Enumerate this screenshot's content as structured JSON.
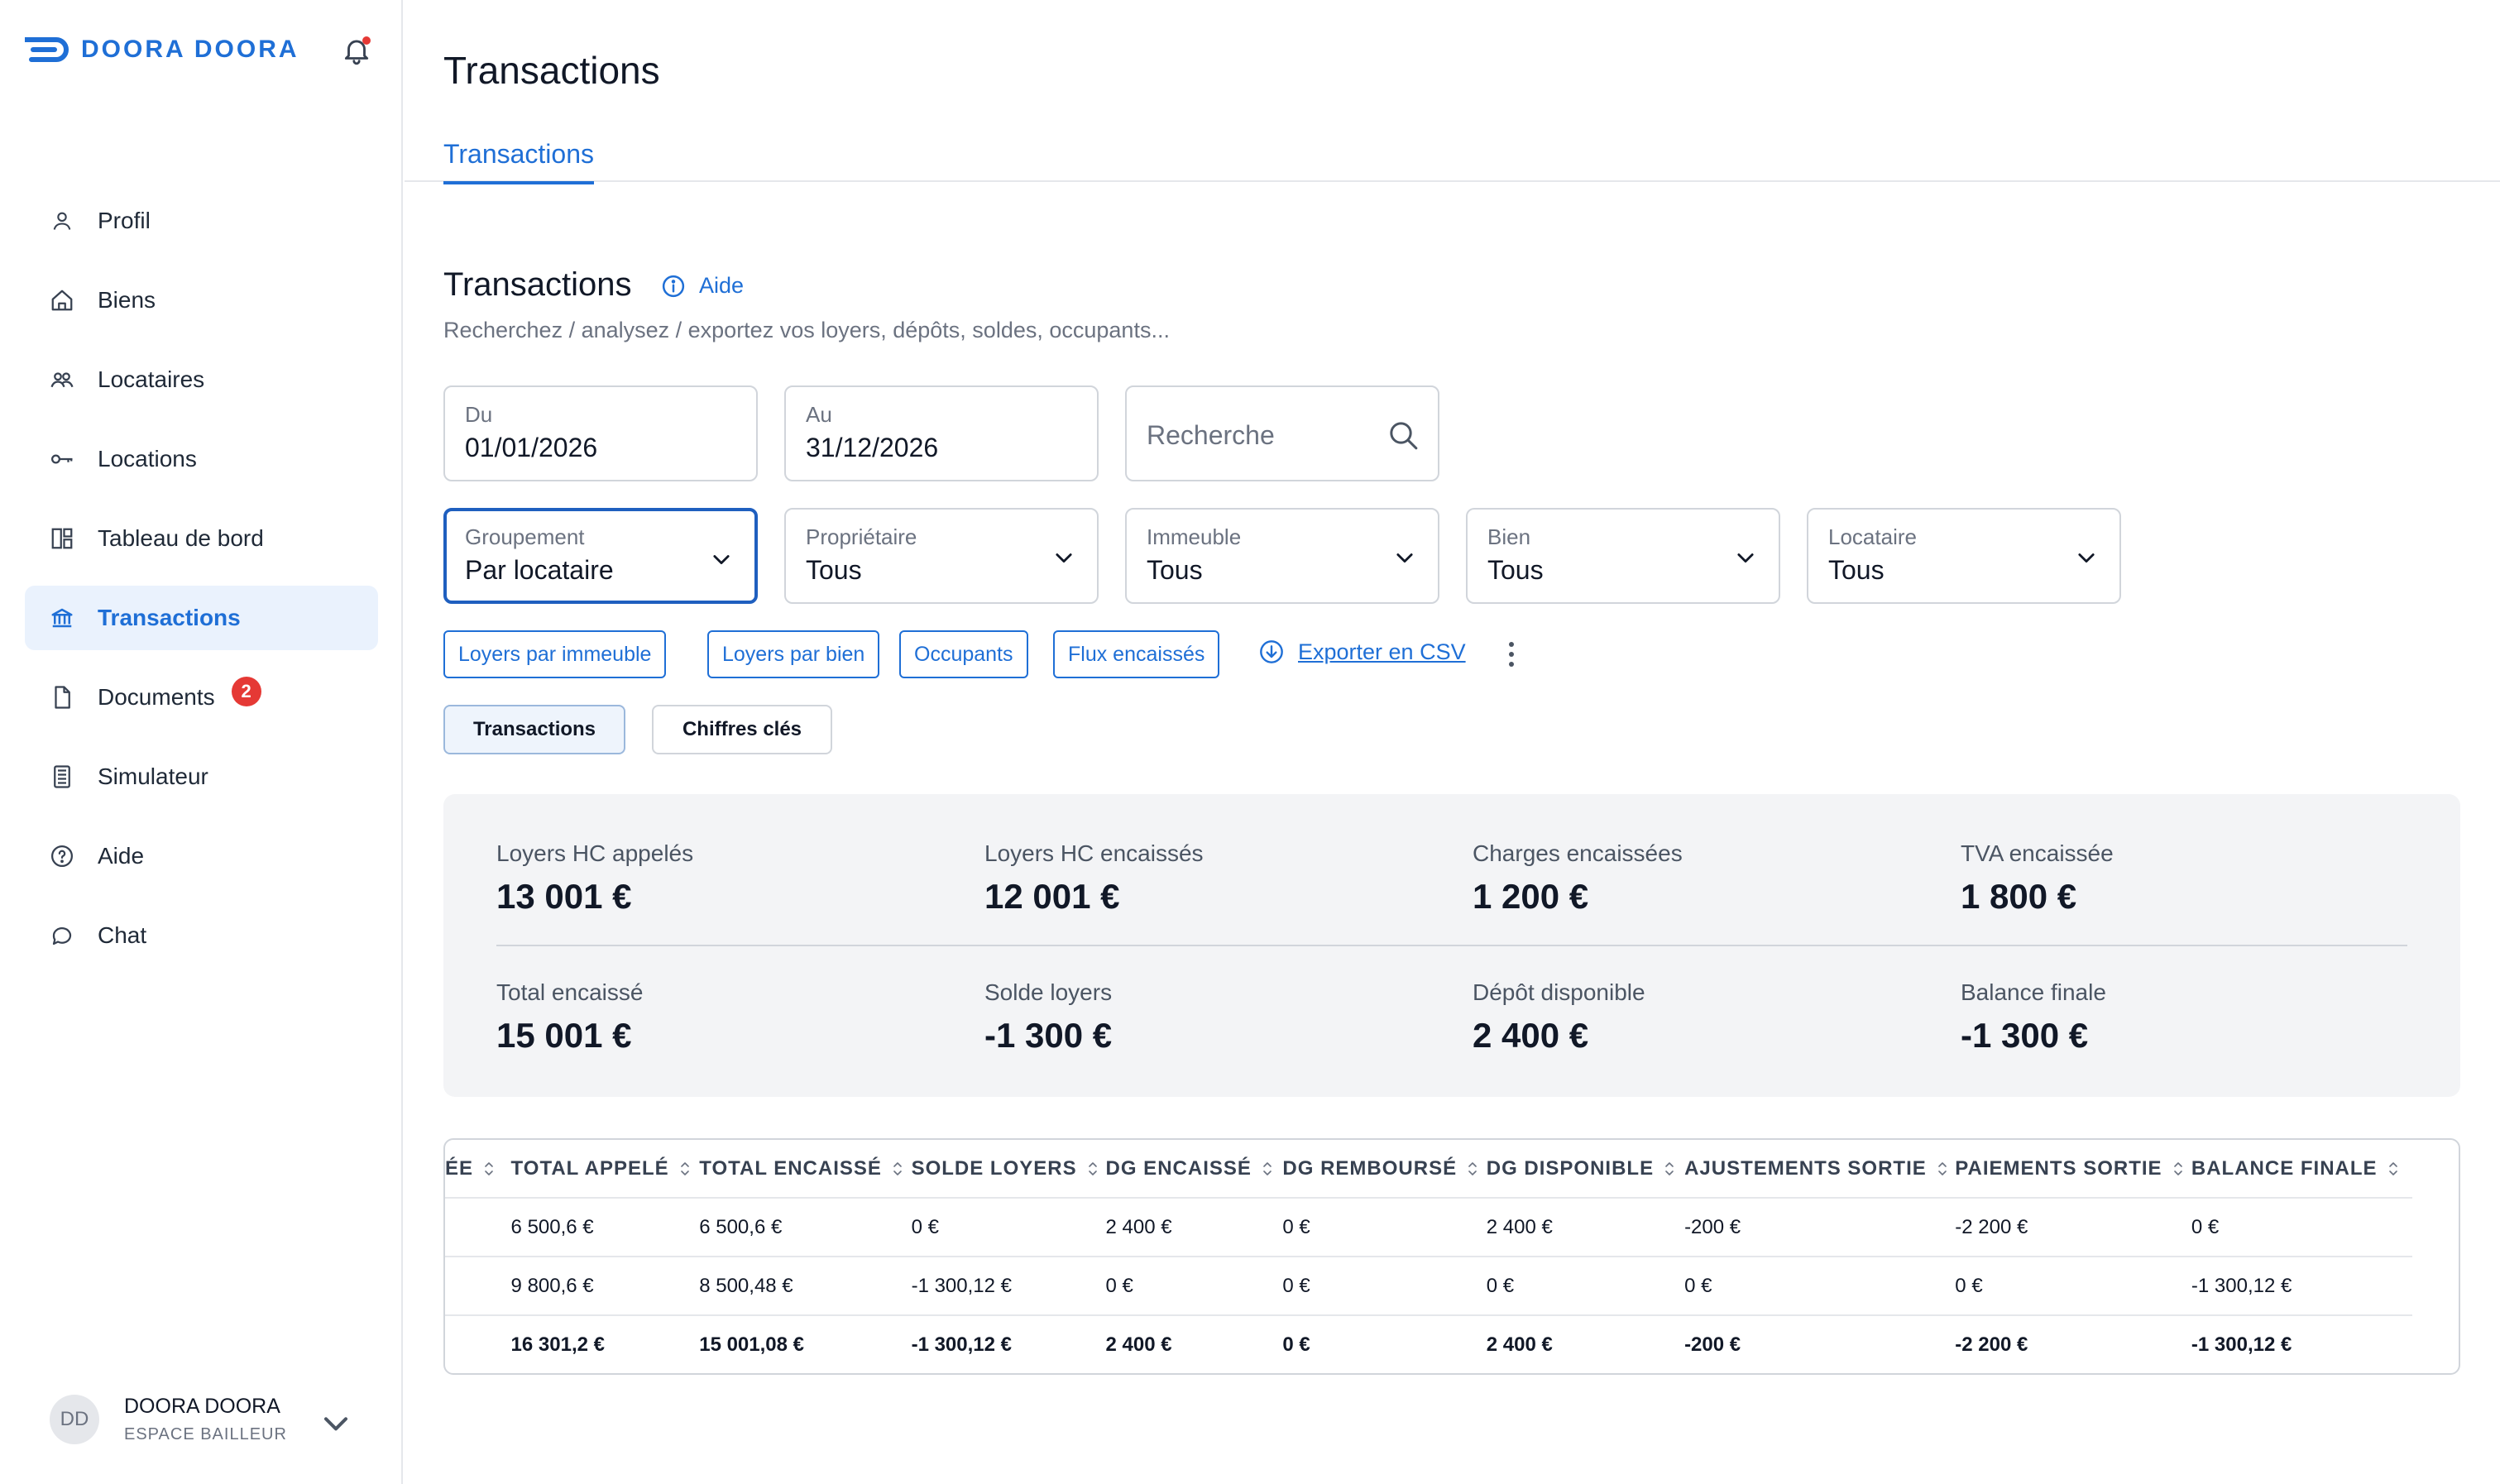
{
  "brand": {
    "name": "DOORA DOORA",
    "color": "#1f6fd6"
  },
  "sidebar": {
    "items": [
      {
        "label": "Profil",
        "icon": "user-icon"
      },
      {
        "label": "Biens",
        "icon": "home-icon"
      },
      {
        "label": "Locataires",
        "icon": "users-icon"
      },
      {
        "label": "Locations",
        "icon": "key-icon"
      },
      {
        "label": "Tableau de bord",
        "icon": "dashboard-icon"
      },
      {
        "label": "Transactions",
        "icon": "bank-icon",
        "active": true
      },
      {
        "label": "Documents",
        "icon": "document-icon",
        "badge": "2"
      },
      {
        "label": "Simulateur",
        "icon": "calculator-icon"
      },
      {
        "label": "Aide",
        "icon": "help-circle-icon"
      },
      {
        "label": "Chat",
        "icon": "chat-icon"
      }
    ],
    "user": {
      "initials": "DD",
      "name": "DOORA DOORA",
      "role": "ESPACE BAILLEUR"
    }
  },
  "page": {
    "title": "Transactions",
    "tab": "Transactions",
    "section_title": "Transactions",
    "help_label": "Aide",
    "subtitle": "Recherchez / analysez / exportez vos loyers, dépôts, soldes, occupants..."
  },
  "filters": {
    "from": {
      "label": "Du",
      "value": "01/01/2026"
    },
    "to": {
      "label": "Au",
      "value": "31/12/2026"
    },
    "search": {
      "placeholder": "Recherche"
    },
    "grouping": {
      "label": "Groupement",
      "value": "Par locataire"
    },
    "owner": {
      "label": "Propriétaire",
      "value": "Tous"
    },
    "building": {
      "label": "Immeuble",
      "value": "Tous"
    },
    "property": {
      "label": "Bien",
      "value": "Tous"
    },
    "tenant": {
      "label": "Locataire",
      "value": "Tous"
    }
  },
  "chips": [
    "Loyers par immeuble",
    "Loyers par bien",
    "Occupants",
    "Flux encaissés"
  ],
  "export_label": "Exporter en CSV",
  "views": {
    "transactions": "Transactions",
    "key_figures": "Chiffres clés"
  },
  "kpis": [
    {
      "label": "Loyers HC appelés",
      "value": "13 001 €"
    },
    {
      "label": "Loyers HC encaissés",
      "value": "12 001 €"
    },
    {
      "label": "Charges encaissées",
      "value": "1 200 €"
    },
    {
      "label": "TVA encaissée",
      "value": "1 800 €"
    },
    {
      "label": "Total encaissé",
      "value": "15 001 €"
    },
    {
      "label": "Solde loyers",
      "value": "-1 300 €"
    },
    {
      "label": "Dépôt disponible",
      "value": "2 400 €"
    },
    {
      "label": "Balance finale",
      "value": "-1 300 €"
    }
  ],
  "table": {
    "headers": [
      "ÉE",
      "TOTAL APPELÉ",
      "TOTAL ENCAISSÉ",
      "SOLDE LOYERS",
      "DG ENCAISSÉ",
      "DG REMBOURSÉ",
      "DG DISPONIBLE",
      "AJUSTEMENTS SORTIE",
      "PAIEMENTS SORTIE",
      "BALANCE FINALE"
    ],
    "rows": [
      [
        "",
        "6 500,6 €",
        "6 500,6 €",
        "0 €",
        "2 400 €",
        "0 €",
        "2 400 €",
        "-200 €",
        "-2 200 €",
        "0 €"
      ],
      [
        "",
        "9 800,6 €",
        "8 500,48 €",
        "-1 300,12 €",
        "0 €",
        "0 €",
        "0 €",
        "0 €",
        "0 €",
        "-1 300,12 €"
      ],
      [
        "",
        "16 301,2 €",
        "15 001,08 €",
        "-1 300,12 €",
        "2 400 €",
        "0 €",
        "2 400 €",
        "-200 €",
        "-2 200 €",
        "-1 300,12 €"
      ]
    ]
  }
}
